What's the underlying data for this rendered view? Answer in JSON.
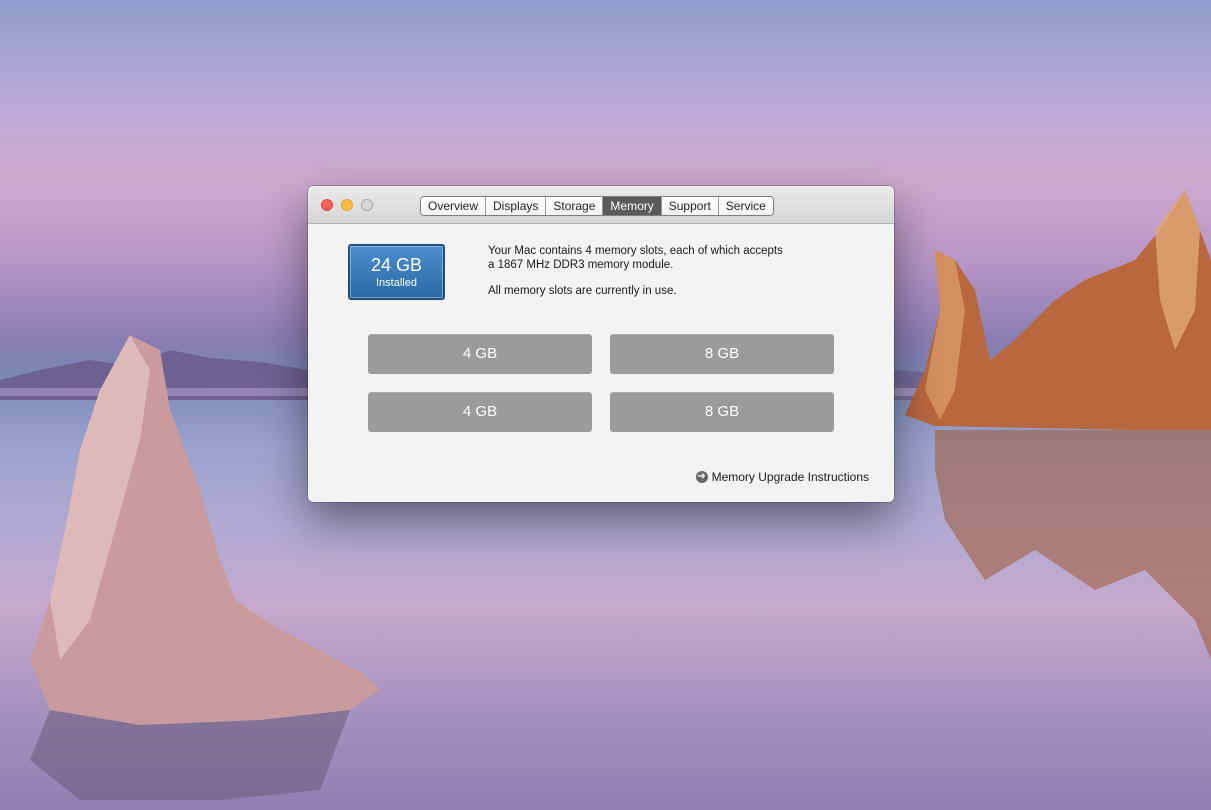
{
  "window": {
    "tabs": [
      "Overview",
      "Displays",
      "Storage",
      "Memory",
      "Support",
      "Service"
    ],
    "active_tab": "Memory"
  },
  "memory": {
    "installed_size": "24 GB",
    "installed_label": "Installed",
    "description_line1": "Your Mac contains 4 memory slots, each of which accepts",
    "description_line2": "a 1867 MHz DDR3 memory module.",
    "status": "All memory slots are currently in use.",
    "slots": [
      "4 GB",
      "8 GB",
      "4 GB",
      "8 GB"
    ],
    "upgrade_link": "Memory Upgrade Instructions"
  },
  "icons": {
    "close": "close-icon",
    "minimize": "minimize-icon",
    "zoom": "zoom-icon",
    "upgrade_arrow": "arrow-right-circle-icon"
  },
  "colors": {
    "installed_badge": "#3a7bbd",
    "slot": "#9b9b9b",
    "active_tab": "#5a5a5a"
  }
}
